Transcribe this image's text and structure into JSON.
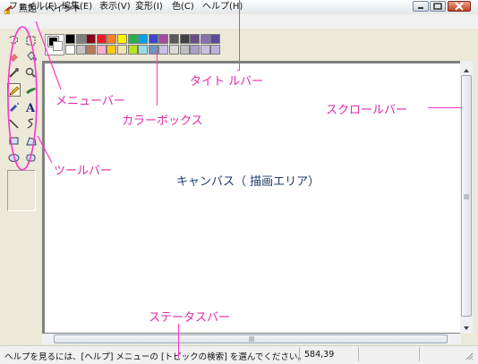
{
  "window": {
    "title": "無題 - ペイント",
    "controls": [
      "minimize-icon",
      "maximize-icon",
      "close-icon"
    ]
  },
  "menus": [
    "ファイル(F)",
    "編集(E)",
    "表示(V)",
    "変形(I)",
    "色(C)",
    "ヘルプ(H)"
  ],
  "tools": [
    "free-select-icon",
    "rect-select-icon",
    "eraser-icon",
    "fill-bucket-icon",
    "color-picker-icon",
    "magnifier-icon",
    "pencil-icon",
    "brush-icon",
    "airbrush-icon",
    "text-icon",
    "line-icon",
    "curve-icon",
    "rectangle-icon",
    "polygon-icon",
    "ellipse-icon",
    "rounded-rect-icon"
  ],
  "palette": {
    "foreground": "#000000",
    "background": "#ffffff",
    "row1": [
      "#000000",
      "#808080",
      "#800000",
      "#808000",
      "#008000",
      "#008080",
      "#000080",
      "#800080",
      "#808040",
      "#004040",
      "#0080ff",
      "#004080",
      "#8000ff",
      "#804000"
    ],
    "row1_visible": [
      "#000000",
      "#7f7f7f",
      "#880015",
      "#ed1c24",
      "#ff7f27",
      "#fff200",
      "#22b14c",
      "#00a2e8",
      "#3f48cc",
      "#a349a4",
      "#5a5a5a",
      "#404040",
      "#6a4a8a",
      "#8a6fb6",
      "#5b4b9a"
    ],
    "row2_visible": [
      "#ffffff",
      "#c3c3c3",
      "#b97a57",
      "#ffaec9",
      "#ffc90e",
      "#efe4b0",
      "#b5e61d",
      "#99d9ea",
      "#7092be",
      "#c8bfe7",
      "#d9d9d9",
      "#bfbfbf",
      "#a8a0c8",
      "#c8c0e0",
      "#bcb4d8"
    ]
  },
  "status": {
    "help_text": "ヘルプを見るには、[ヘルプ] メニューの [トピックの検索] を選んでください。",
    "coordinates": "584,39"
  },
  "annotations": {
    "title_bar": "タイト ルバー",
    "menu_bar": "メニューバー",
    "color_box": "カラーボックス",
    "scroll_bar": "スクロールバー",
    "tool_bar": "ツールバー",
    "canvas": "キャンバス（ 描画エリア）",
    "status_bar": "ステータスバー"
  }
}
